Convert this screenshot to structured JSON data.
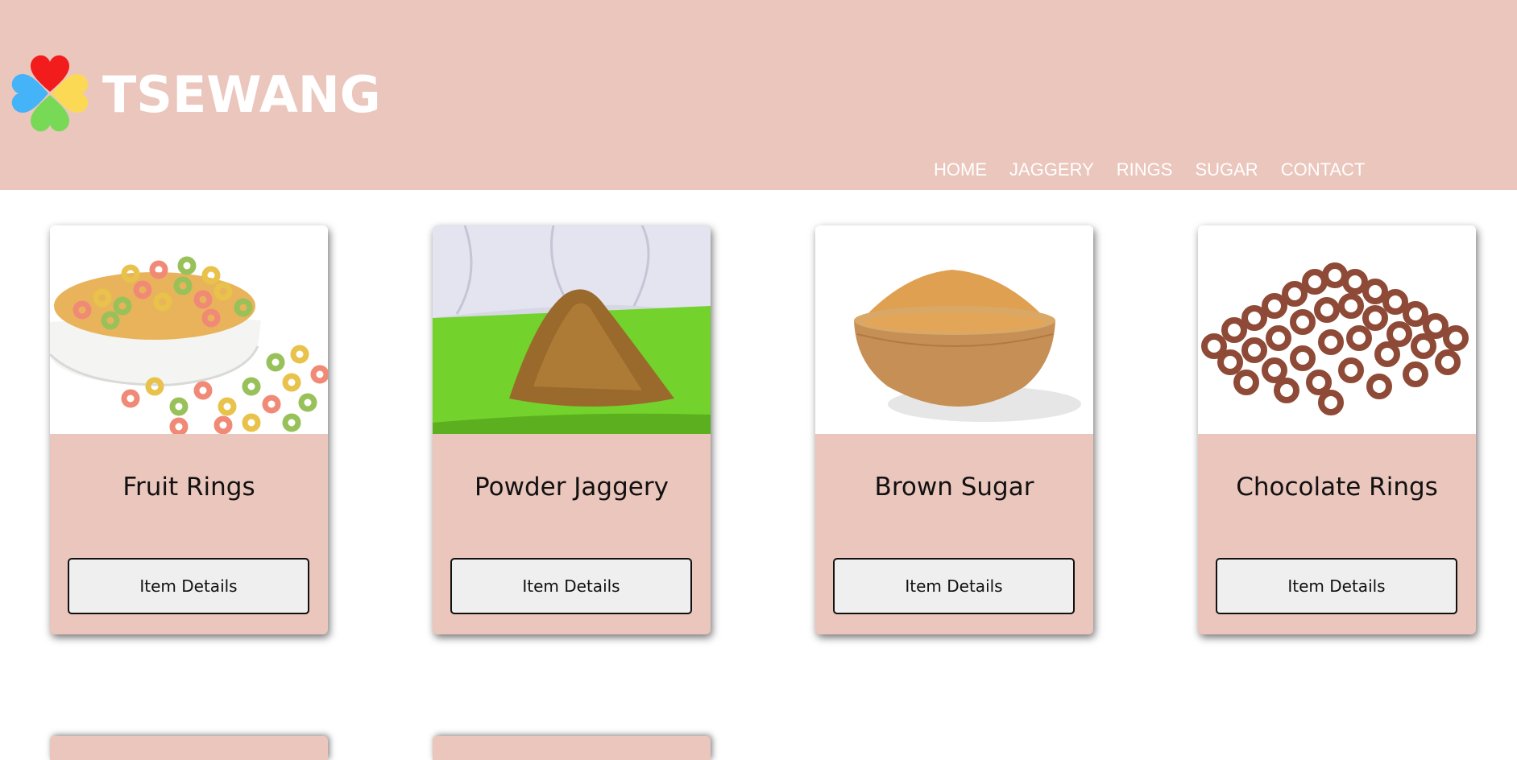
{
  "brand": {
    "name": "TSEWANG",
    "logo_icon": "four-heart-clover-logo",
    "colors": {
      "header_bg": "#ebc6bd",
      "card_bg": "#ebc6bd",
      "heart_red": "#f21c1c",
      "heart_yellow": "#fbd955",
      "heart_green": "#78d957",
      "heart_blue": "#45b3f7"
    }
  },
  "nav": {
    "items": [
      {
        "label": "HOME"
      },
      {
        "label": "JAGGERY"
      },
      {
        "label": "RINGS"
      },
      {
        "label": "SUGAR"
      },
      {
        "label": "CONTACT"
      }
    ]
  },
  "products": [
    {
      "title": "Fruit Rings",
      "button": "Item Details",
      "image": "fruit-rings-bowl-image"
    },
    {
      "title": "Powder Jaggery",
      "button": "Item Details",
      "image": "powder-jaggery-plate-image"
    },
    {
      "title": "Brown Sugar",
      "button": "Item Details",
      "image": "brown-sugar-bowl-image"
    },
    {
      "title": "Chocolate Rings",
      "button": "Item Details",
      "image": "chocolate-rings-pile-image"
    }
  ]
}
